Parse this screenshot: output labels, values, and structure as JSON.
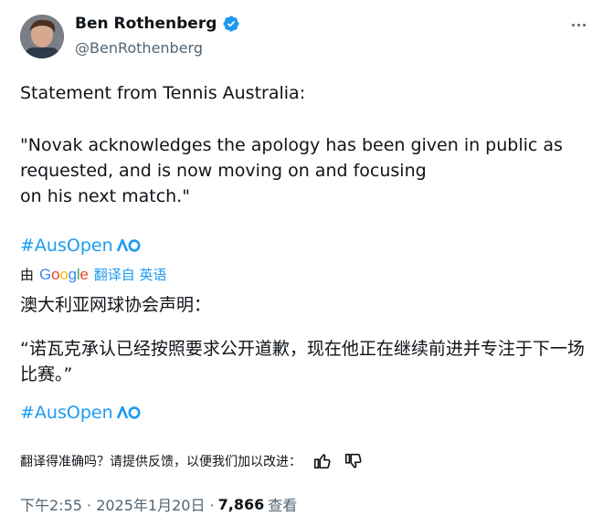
{
  "author": {
    "name": "Ben Rothenberg",
    "handle": "@BenRothenberg"
  },
  "tweet": {
    "line1": "Statement from Tennis Australia:",
    "quote": "\"Novak acknowledges the apology has been given in public as requested, and is now moving on and focusing\non his next match.\"",
    "hashtag": "#AusOpen"
  },
  "translation": {
    "by_label": "由",
    "provider": "Google",
    "from_label": "翻译自 英语",
    "line1": "澳大利亚网球协会声明：",
    "quote": "“诺瓦克承认已经按照要求公开道歉，现在他正在继续前进并专注于下一场比赛。”",
    "hashtag": "#AusOpen",
    "feedback_prompt": "翻译得准确吗？请提供反馈，以便我们加以改进："
  },
  "meta": {
    "time": "下午2:55 · 2025年1月20日 · ",
    "views_count": "7,866",
    "views_label": "查看"
  },
  "colors": {
    "link": "#1d9bf0",
    "text": "#0f1419",
    "secondary": "#536471"
  },
  "icons": [
    "verified-badge-icon",
    "more-options-icon",
    "ausopen-ao-icon",
    "thumbs-up-icon",
    "thumbs-down-icon"
  ]
}
